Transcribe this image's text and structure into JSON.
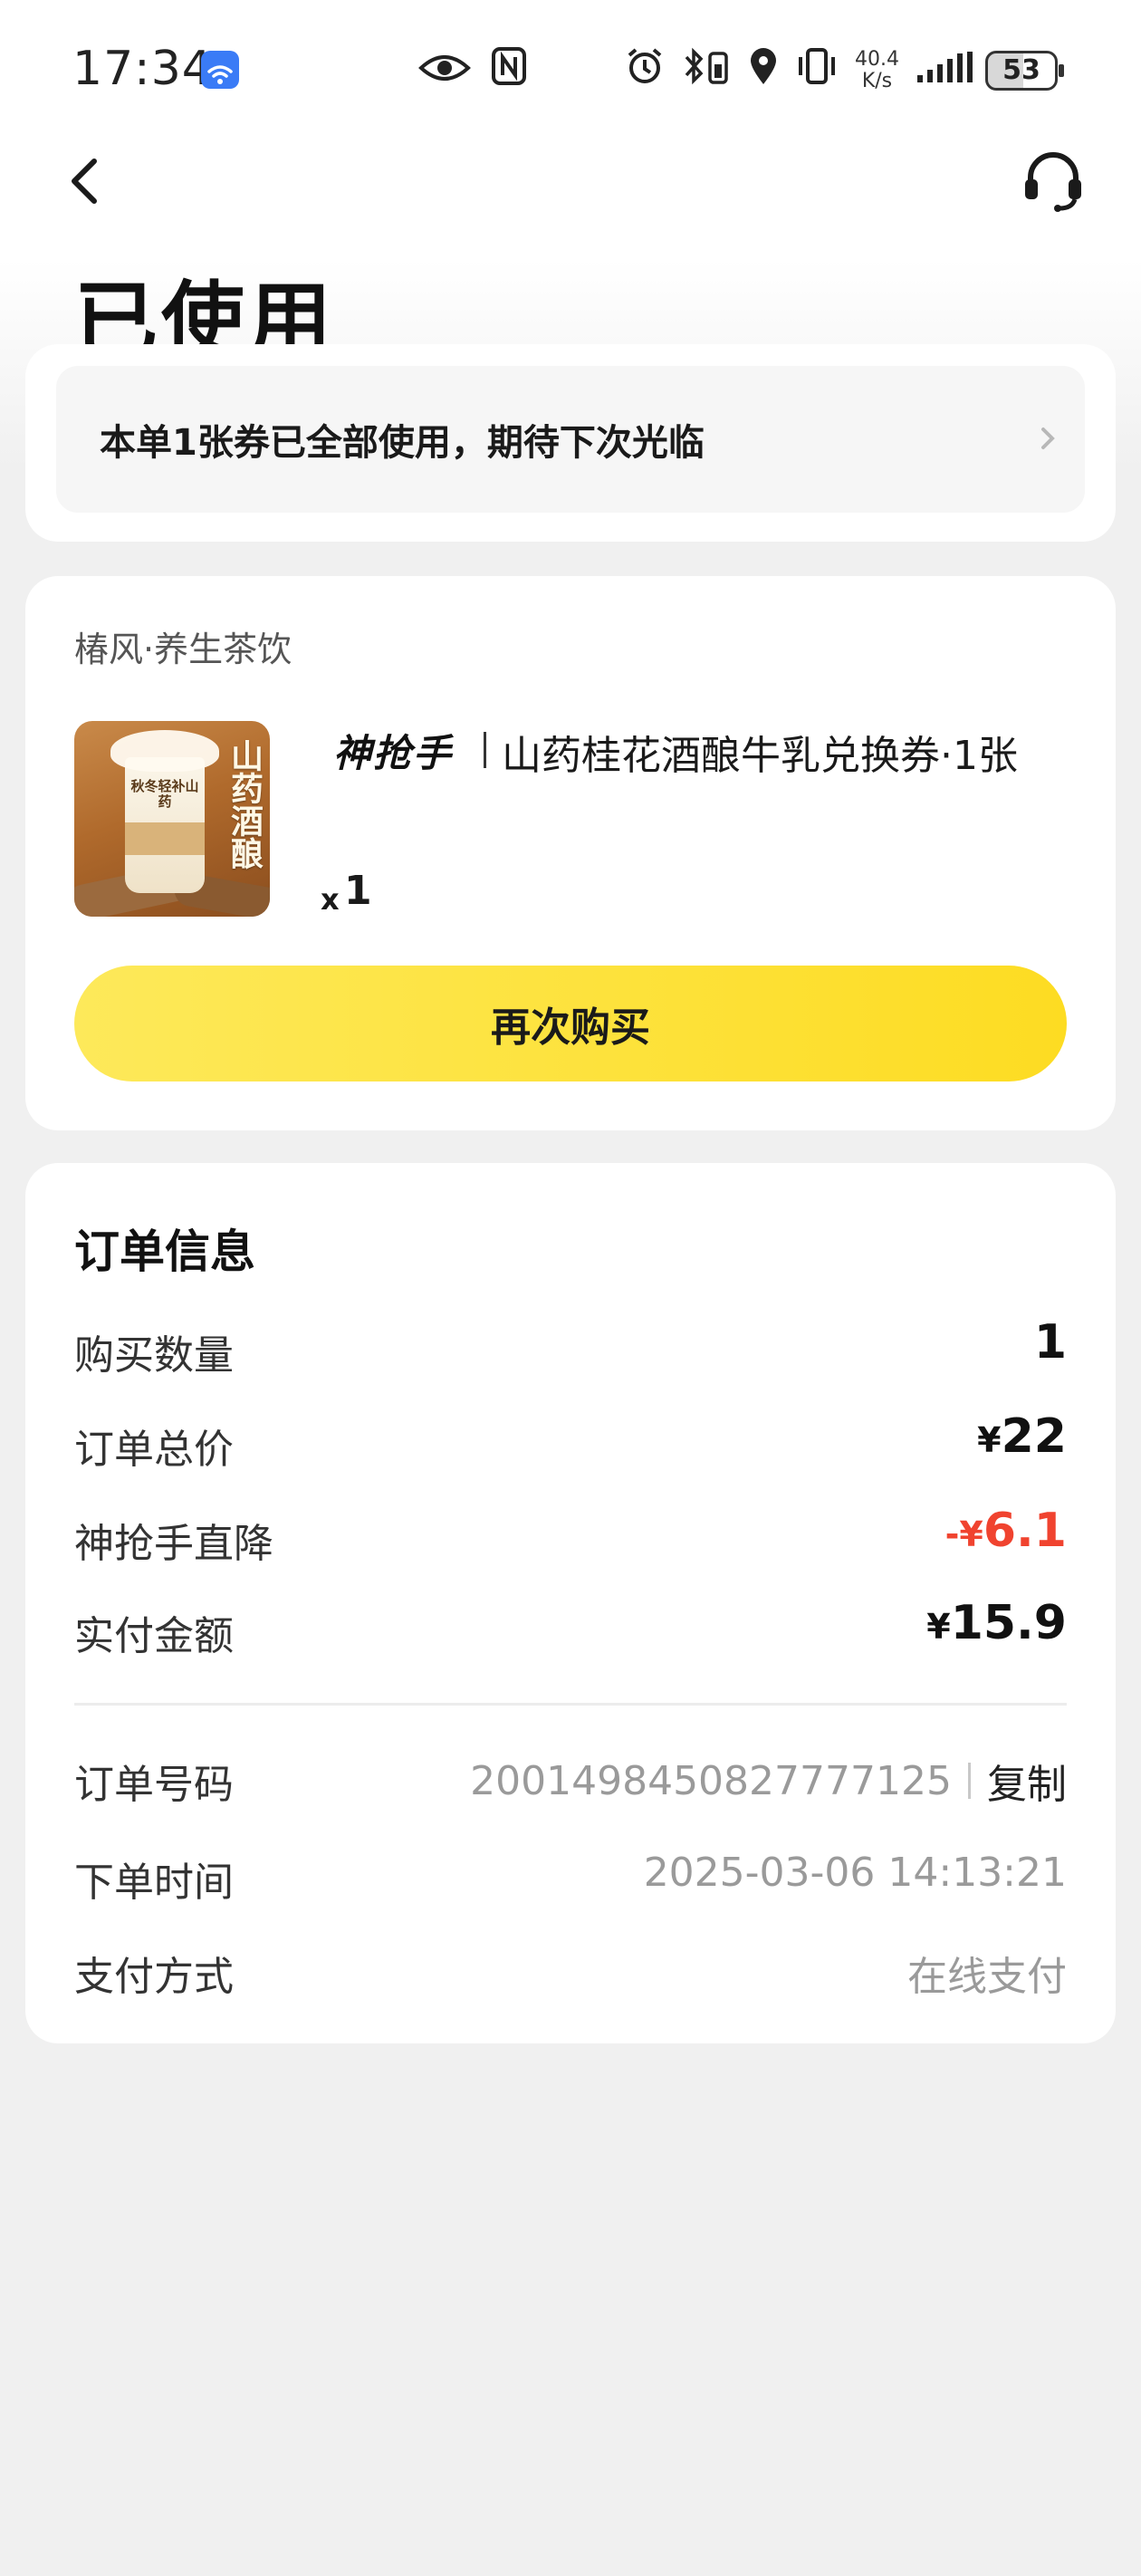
{
  "status_bar": {
    "time": "17:34",
    "net_speed_value": "40.4",
    "net_speed_unit": "K/s",
    "battery": "53"
  },
  "header": {
    "title": "已使用"
  },
  "status_notice": {
    "text": "本单1张券已全部使用，期待下次光临"
  },
  "product": {
    "shop_name": "椿风·养生茶饮",
    "brand_logo": "神抢手",
    "name": "山药桂花酒酿牛乳兑换券·1张",
    "image_text": "山药酒酿",
    "image_sticker": "秋冬轻补山药",
    "qty_prefix": "x",
    "qty": "1",
    "rebuy_label": "再次购买"
  },
  "order_info": {
    "title": "订单信息",
    "rows": [
      {
        "label": "购买数量",
        "currency": "",
        "value": "1"
      },
      {
        "label": "订单总价",
        "currency": "¥",
        "value": "22"
      },
      {
        "label": "神抢手直降",
        "currency": "-¥",
        "value": "6.1"
      },
      {
        "label": "实付金额",
        "currency": "¥",
        "value": "15.9"
      }
    ],
    "order_no_label": "订单号码",
    "order_no": "2001498450827777125",
    "copy_label": "复制",
    "order_time_label": "下单时间",
    "order_time": "2025-03-06 14:13:21",
    "payment_label": "支付方式",
    "payment": "在线支付"
  },
  "colors": {
    "accent_yellow": "#fddc22",
    "discount_red": "#f0432f",
    "muted_text": "#9a9a9a",
    "background": "#f0f0f0"
  },
  "icons": [
    "wifi-icon",
    "eye-icon",
    "nfc-icon",
    "alarm-icon",
    "bluetooth-icon",
    "location-icon",
    "vibrate-icon",
    "signal-icon",
    "battery-icon",
    "back-icon",
    "headset-icon",
    "chevron-right-icon"
  ]
}
